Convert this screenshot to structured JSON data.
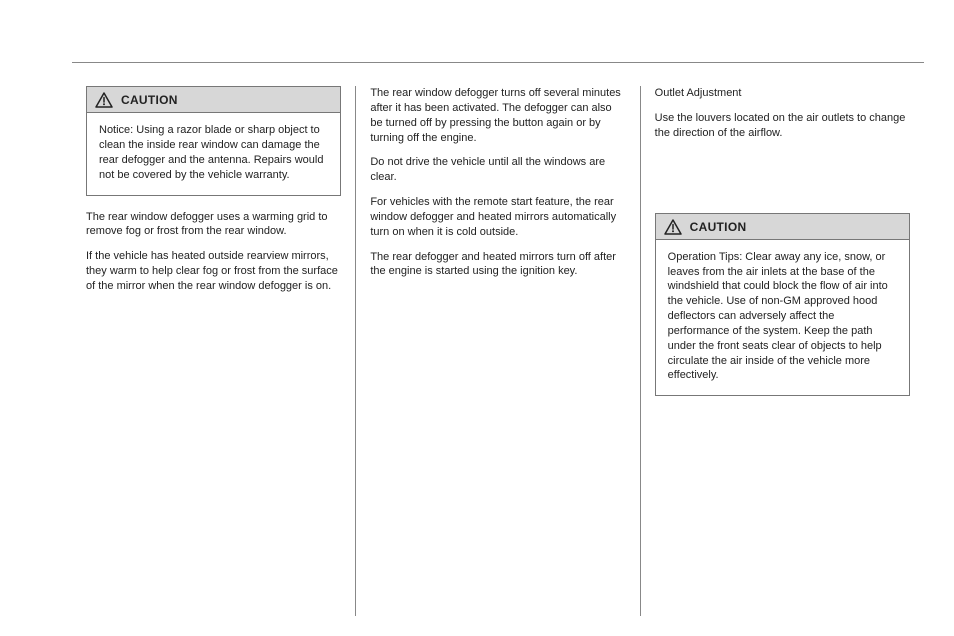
{
  "header": {
    "section_title": ""
  },
  "columns": {
    "col1": {
      "caution_box": {
        "label": "CAUTION",
        "body": "Notice: Using a razor blade or sharp object to clean the inside rear window can damage the rear defogger and the antenna. Repairs would not be covered by the vehicle warranty."
      },
      "paragraphs": [
        "The rear window defogger uses a warming grid to remove fog or frost from the rear window.",
        "If the vehicle has heated outside rearview mirrors, they warm to help clear fog or frost from the surface of the mirror when the rear window defogger is on."
      ]
    },
    "col2": {
      "paragraphs": [
        "The rear window defogger turns off several minutes after it has been activated. The defogger can also be turned off by pressing the button again or by turning off the engine.",
        "Do not drive the vehicle until all the windows are clear.",
        "For vehicles with the remote start feature, the rear window defogger and heated mirrors automatically turn on when it is cold outside.",
        "The rear defogger and heated mirrors turn off after the engine is started using the ignition key."
      ]
    },
    "col3": {
      "intro": [
        "Outlet Adjustment",
        "Use the louvers located on the air outlets to change the direction of the airflow."
      ],
      "caution_box": {
        "label": "CAUTION",
        "body": "Operation Tips: Clear away any ice, snow, or leaves from the air inlets at the base of the windshield that could block the flow of air into the vehicle. Use of non-GM approved hood deflectors can adversely affect the performance of the system. Keep the path under the front seats clear of objects to help circulate the air inside of the vehicle more effectively."
      },
      "after": [
        ""
      ]
    }
  }
}
